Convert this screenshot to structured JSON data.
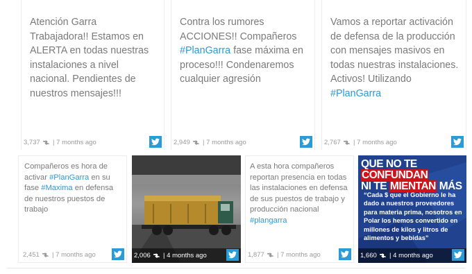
{
  "colors": {
    "twitter_blue": "#2a9bd6",
    "hashtag": "#2d98d4"
  },
  "cards_top": [
    {
      "text_before": "Atención Garra Trabajadora!! Estamos en ALERTA en todas nuestras instalaciones a nivel nacional. Pendientes de nuestros mensajes!!!",
      "hashtag": "",
      "text_after": "",
      "retweets": "3,737",
      "time": "7 months ago"
    },
    {
      "text_before": "Contra los rumores ACCIONES!! Compañeros ",
      "hashtag": "#PlanGarra",
      "text_after": " fase máxima en proceso!!! Condenaremos cualquier agresión",
      "retweets": "2,949",
      "time": "7 months ago"
    },
    {
      "text_before": "Vamos a reportar activación de defensa de la producción con mensajes masivos en todas nuestras instalaciones. Activos! Utilizando ",
      "hashtag": "#PlanGarra",
      "text_after": "",
      "retweets": "2,767",
      "time": "7 months ago"
    }
  ],
  "cards_bottom": {
    "tweet1": {
      "p1": "Compañeros es hora de activar ",
      "tag1": "#PlanGarra",
      "p2": " en su fase ",
      "tag2": "#Maxima",
      "p3": " en defensa de nuestros puestos de trabajo",
      "retweets": "2,451",
      "time": "7 months ago"
    },
    "video": {
      "retweets": "2,006",
      "time": "4 months ago"
    },
    "tweet3": {
      "text": "A esta hora compañeros reportan presencia en todas las instalaciones en defensa de sus puestos de trabajo y producción nacional ",
      "hashtag": "#plangarra",
      "retweets": "1,877",
      "time": "7 months ago"
    },
    "poster": {
      "heading1_a": "QUE NO TE ",
      "heading1_b": "CONFUNDAN",
      "heading2_a": "NI TE ",
      "heading2_b": "MIENTAN",
      "heading2_c": " MÁS",
      "quote": "“Cada $ que el Gobierno le ha dado a nuestros proveedores para materia prima, nosotros en Polar los hemos convertido en millones de kilos y litros de alimentos y bebidas”",
      "retweets": "1,660",
      "time": "4 months ago"
    }
  }
}
